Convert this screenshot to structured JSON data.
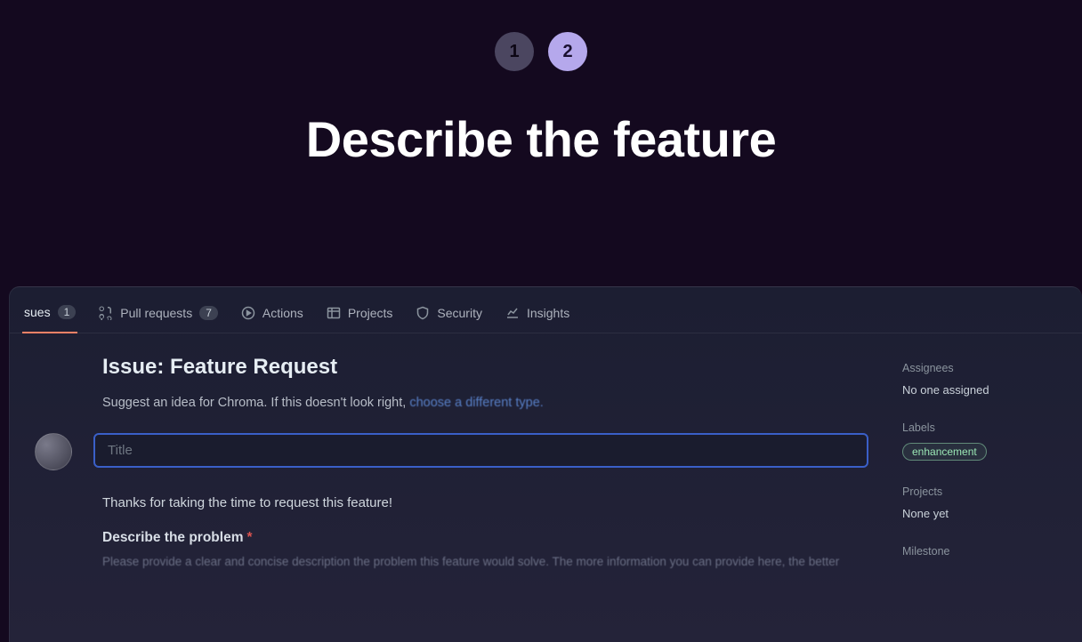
{
  "hero": {
    "step1": "1",
    "step2": "2",
    "title": "Describe the feature"
  },
  "tabs": {
    "issues": {
      "label": "sues",
      "count": "1"
    },
    "pulls": {
      "label": "Pull requests",
      "count": "7"
    },
    "actions": {
      "label": "Actions"
    },
    "projects": {
      "label": "Projects"
    },
    "security": {
      "label": "Security"
    },
    "insights": {
      "label": "Insights"
    }
  },
  "issue": {
    "heading": "Issue: Feature Request",
    "subText": "Suggest an idea for Chroma. If this doesn't look right, ",
    "subLink": "choose a different type.",
    "titlePlaceholder": "Title",
    "thanks": "Thanks for taking the time to request this feature!",
    "problemLabel": "Describe the problem",
    "problemHelp": "Please provide a clear and concise description the problem this feature would solve. The more information you can provide here, the better"
  },
  "sidebar": {
    "assigneesLabel": "Assignees",
    "assigneesValue": "No one assigned",
    "labelsLabel": "Labels",
    "labelChip": "enhancement",
    "projectsLabel": "Projects",
    "projectsValue": "None yet",
    "milestoneLabel": "Milestone"
  }
}
